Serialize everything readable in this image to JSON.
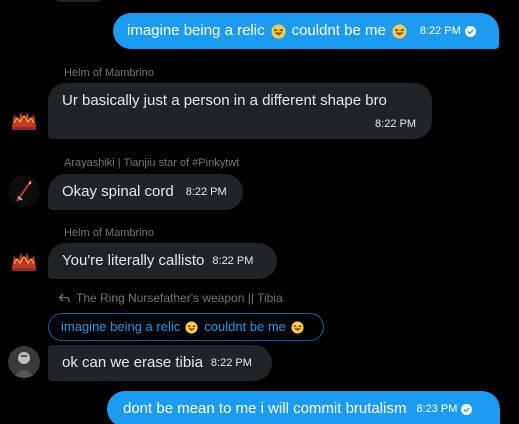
{
  "colors": {
    "background": "#000000",
    "outgoing_bubble": "#1d9bf0",
    "incoming_bubble": "#202327",
    "muted_text": "#71767b",
    "primary_text": "#e7e9ea"
  },
  "messages": [
    {
      "direction": "outgoing",
      "text_before": "imagine being a relic",
      "text_after": "couldnt be me",
      "emoji": "grinning-squinting-tongue",
      "time": "8:22 PM",
      "read": true
    },
    {
      "direction": "incoming",
      "sender": "Helm of Mambrino",
      "text": "Ur basically just a person in a different shape bro",
      "time": "8:22 PM",
      "avatar": "red-crown-avatar"
    },
    {
      "direction": "incoming",
      "sender": "Arayashiki | Tianjiu star of #Pinkytwt",
      "text": "Okay spinal cord",
      "time": "8:22 PM",
      "avatar": "sword-avatar"
    },
    {
      "direction": "incoming",
      "sender": "Helm of Mambrino",
      "text": "You're literally callisto",
      "time": "8:22 PM",
      "avatar": "red-crown-avatar"
    },
    {
      "direction": "incoming",
      "reply_to_name": "The Ring Nursefather's weapon || Tibia",
      "quoted_before": "imagine being a relic",
      "quoted_after": "couldnt be me",
      "text": "ok can we erase tibia",
      "time": "8:22 PM",
      "avatar": "dark-figure-avatar"
    },
    {
      "direction": "outgoing",
      "text": "dont be mean to me i will commit brutalism",
      "time": "8:23 PM",
      "read": true
    }
  ]
}
